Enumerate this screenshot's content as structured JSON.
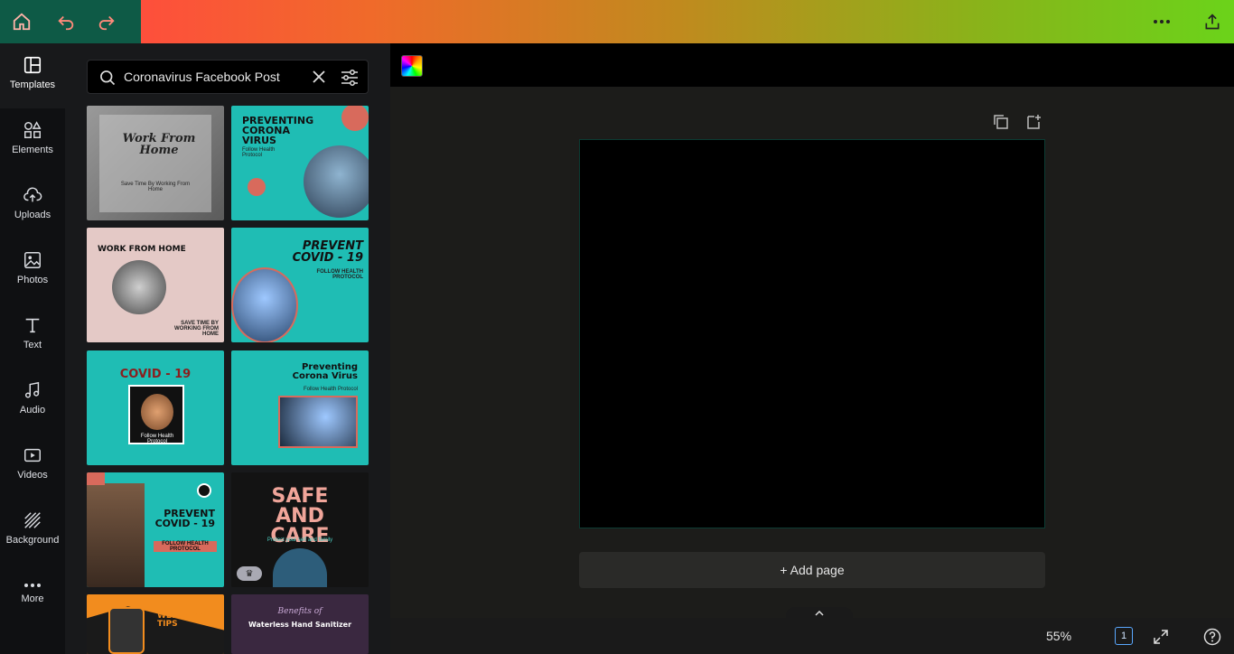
{
  "topbar": {
    "home_icon": "home-icon",
    "undo_icon": "undo-icon",
    "redo_icon": "redo-icon",
    "more_icon": "more-horizontal-icon",
    "share_icon": "share-icon"
  },
  "rail": {
    "items": [
      {
        "label": "Templates",
        "icon": "layout-icon"
      },
      {
        "label": "Elements",
        "icon": "shapes-icon"
      },
      {
        "label": "Uploads",
        "icon": "cloud-upload-icon"
      },
      {
        "label": "Photos",
        "icon": "image-icon"
      },
      {
        "label": "Text",
        "icon": "text-icon"
      },
      {
        "label": "Audio",
        "icon": "music-icon"
      },
      {
        "label": "Videos",
        "icon": "video-icon"
      },
      {
        "label": "Background",
        "icon": "pattern-icon"
      },
      {
        "label": "More",
        "icon": "more-icon"
      }
    ]
  },
  "search": {
    "value": "Coronavirus Facebook Post"
  },
  "templates": [
    {
      "title": "Work From Home",
      "sub": "Save Time By Working From Home"
    },
    {
      "title": "PREVENTING CORONA VIRUS",
      "sub": "Follow Health Protocol"
    },
    {
      "title": "WORK FROM HOME",
      "sub": "SAVE TIME BY WORKING FROM HOME"
    },
    {
      "title": "PREVENT COVID - 19",
      "sub": "FOLLOW HEALTH PROTOCOL"
    },
    {
      "title": "COVID - 19",
      "sub": "Follow Health Protocol"
    },
    {
      "title": "Preventing Corona Virus",
      "sub": "Follow Health Protocol"
    },
    {
      "title": "PREVENT COVID - 19",
      "sub": "FOLLOW HEALTH PROTOCOL"
    },
    {
      "title": "SAFE AND CARE",
      "sub": "Protect your self and family"
    },
    {
      "title": "WELLNESS TIPS",
      "sub": ""
    },
    {
      "title": "Waterless Hand Sanitizer",
      "sub": "Benefits of"
    }
  ],
  "canvas": {
    "add_page_label": "+ Add page"
  },
  "footer": {
    "zoom": "55%",
    "page_number": "1"
  }
}
